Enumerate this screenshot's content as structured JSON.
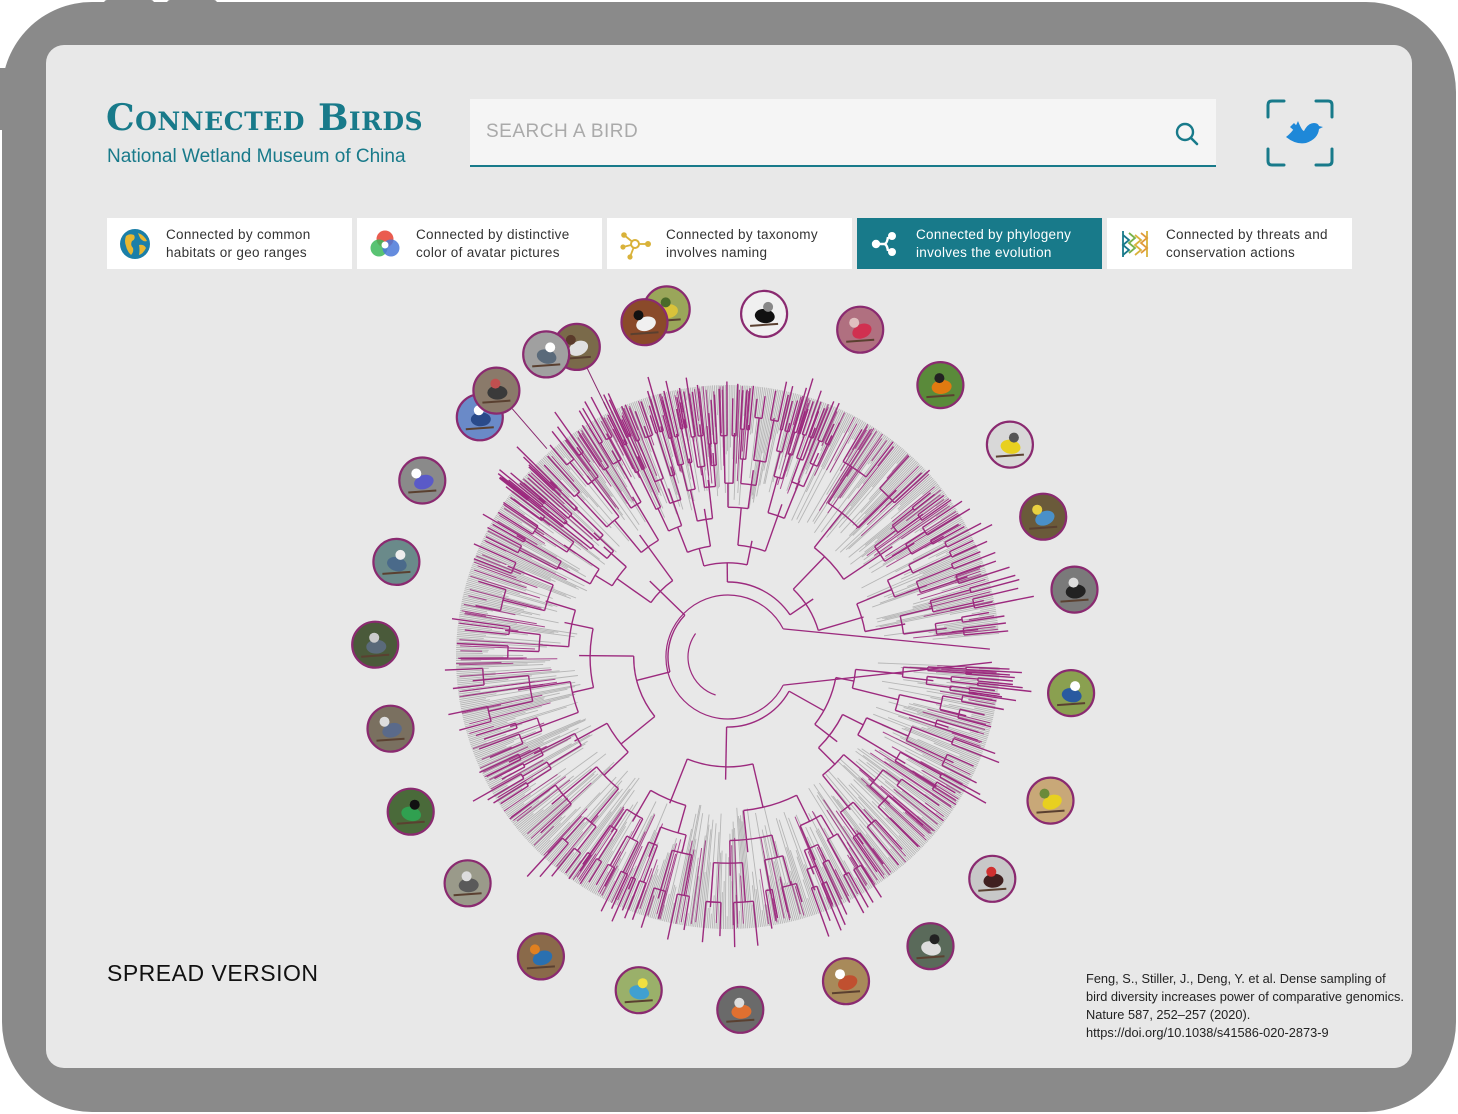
{
  "app": {
    "title": "Connected Birds",
    "subtitle": "National Wetland Museum of China"
  },
  "search": {
    "placeholder": "SEARCH A BIRD",
    "value": "",
    "icon": "search-icon"
  },
  "scan_button": {
    "icon": "bird-scan-icon",
    "accent": "#1e88d8"
  },
  "tabs": [
    {
      "label": "Connected by common habitats or geo ranges",
      "icon": "globe-icon",
      "active": false
    },
    {
      "label": "Connected by distinctive color of avatar pictures",
      "icon": "color-circles-icon",
      "active": false
    },
    {
      "label": "Connected by taxonomy involves naming",
      "icon": "network-node-icon",
      "active": false
    },
    {
      "label": "Connected by phylogeny involves the evolution",
      "icon": "branch-icon",
      "active": true
    },
    {
      "label": "Connected by threats and conservation actions",
      "icon": "threat-lines-icon",
      "active": false
    }
  ],
  "tree": {
    "bird_count": 26,
    "highlight_color": "#9c2a7e",
    "base_color": "#8c8c8c",
    "accent": "#187a8a"
  },
  "footer": {
    "mode_label": "SPREAD VERSION",
    "citation": "Feng, S., Stiller, J., Deng, Y. et al. Dense sampling of bird diversity increases power of comparative genomics. Nature 587, 252–257 (2020). https://doi.org/10.1038/s41586-020-2873-9"
  }
}
